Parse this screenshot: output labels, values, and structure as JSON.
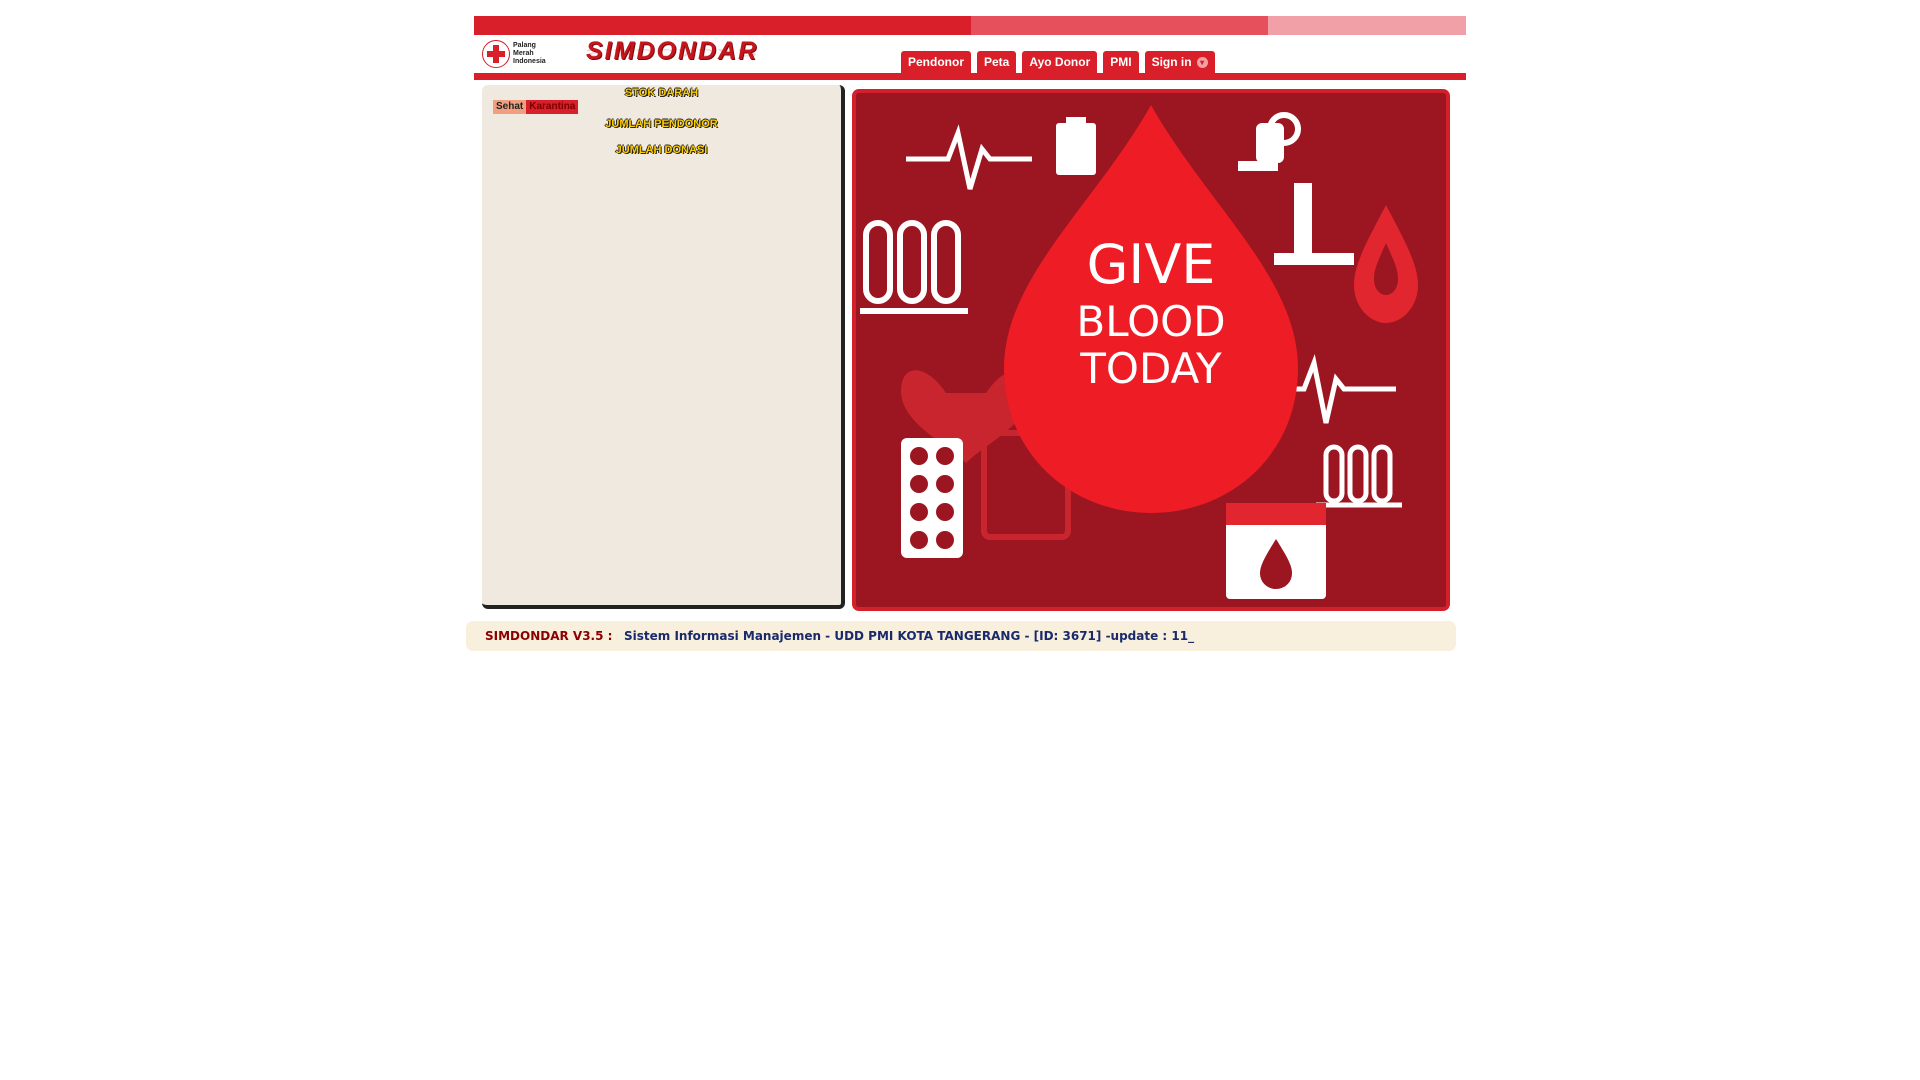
{
  "header": {
    "org_name_lines": [
      "Palang",
      "Merah",
      "Indonesia"
    ],
    "brand": "SIMDONDAR",
    "nav": [
      {
        "label": "Pendonor"
      },
      {
        "label": "Peta"
      },
      {
        "label": "Ayo Donor"
      },
      {
        "label": "PMI"
      },
      {
        "label": "Sign in",
        "has_dropdown": true
      }
    ]
  },
  "left_panel": {
    "stok_darah": "STOK DARAH",
    "legend": {
      "sehat": "Sehat",
      "karantina": "Karantina"
    },
    "jumlah_pendonor": "JUMLAH PENDONOR",
    "jumlah_donasi": "JUMLAH DONASI"
  },
  "banner": {
    "lines": [
      "GIVE",
      "BLOOD",
      "TODAY"
    ]
  },
  "footer": {
    "version": "SIMDONDAR V3.5 :",
    "marquee": "Sistem Informasi Manajemen - UDD PMI KOTA TANGERANG - [ID: 3671] -update : 11_"
  },
  "colors": {
    "primary_red": "#d81f2a",
    "panel_bg": "#efe9df",
    "footer_bg": "#f8efdc",
    "stat_text": "#ffcc00"
  }
}
